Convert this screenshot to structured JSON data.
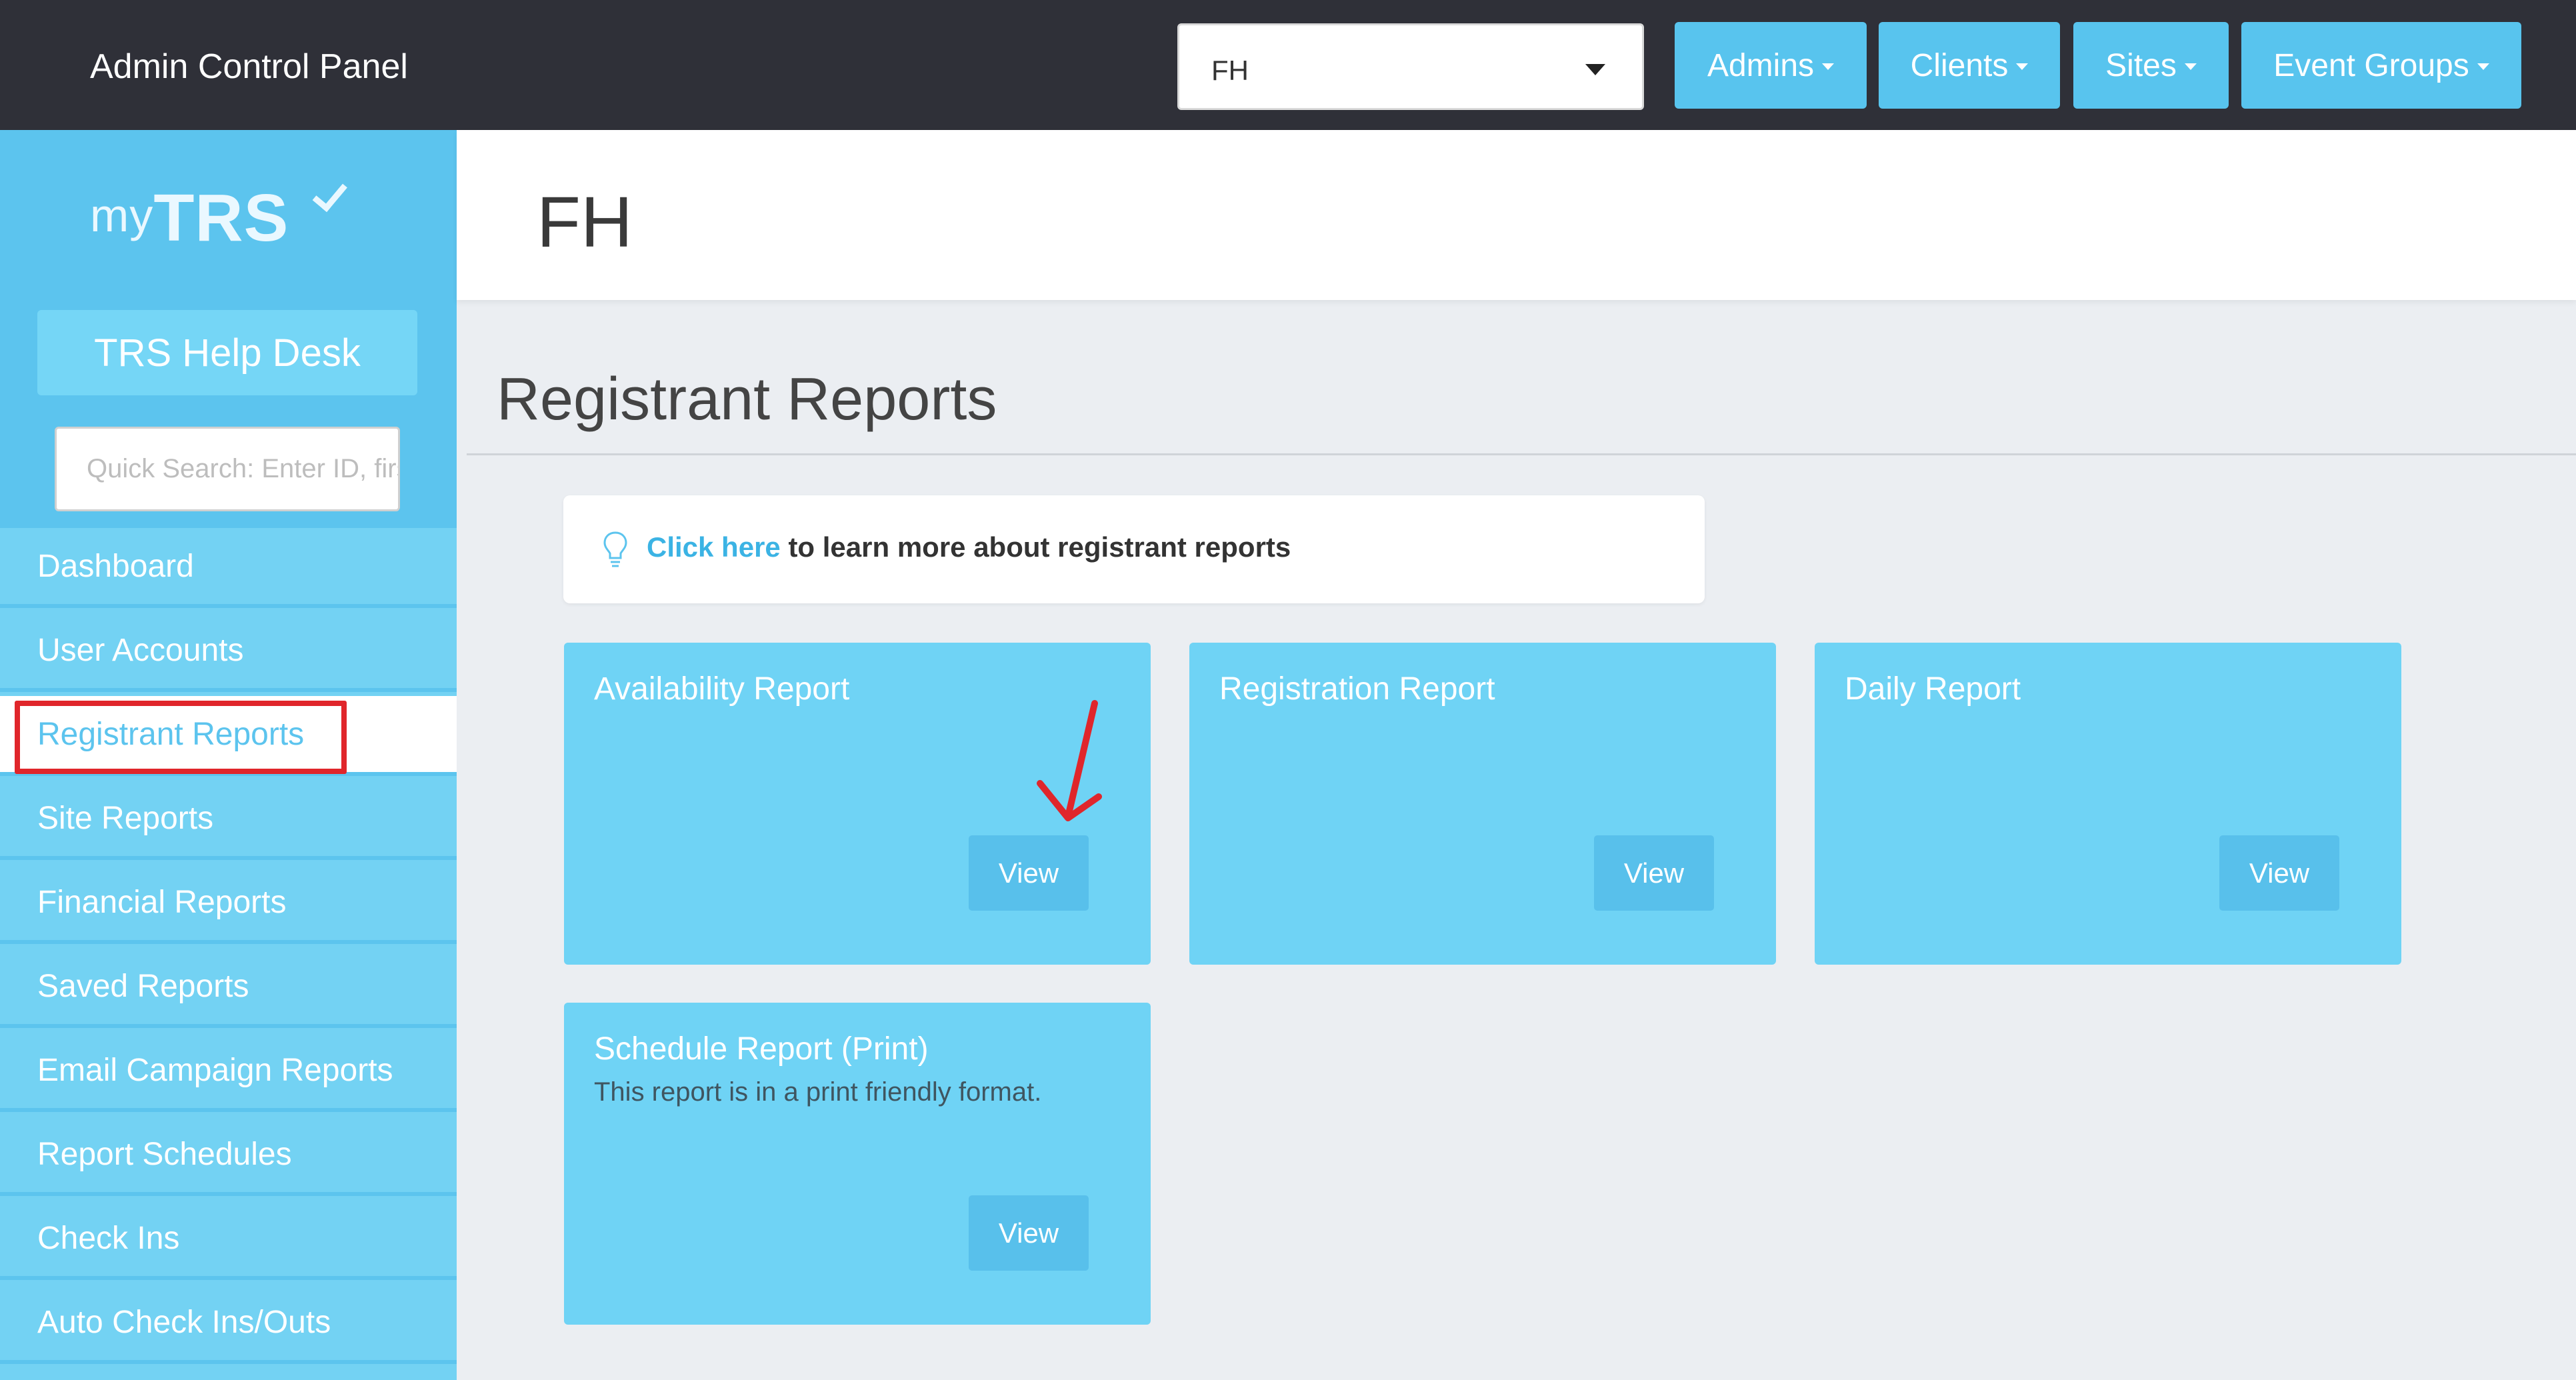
{
  "topbar": {
    "app_title": "Admin Control Panel",
    "client_select": {
      "value": "FH"
    },
    "menus": [
      {
        "label": "Admins"
      },
      {
        "label": "Clients"
      },
      {
        "label": "Sites"
      },
      {
        "label": "Event Groups"
      }
    ]
  },
  "sidebar": {
    "logo": {
      "prefix": "my",
      "brand": "TRS"
    },
    "help_desk_label": "TRS Help Desk",
    "quick_search": {
      "placeholder": "Quick Search: Enter ID, first or last name",
      "value": ""
    },
    "items": [
      {
        "label": "Dashboard",
        "active": false
      },
      {
        "label": "User Accounts",
        "active": false
      },
      {
        "label": "Registrant Reports",
        "active": true
      },
      {
        "label": "Site Reports",
        "active": false
      },
      {
        "label": "Financial Reports",
        "active": false
      },
      {
        "label": "Saved Reports",
        "active": false
      },
      {
        "label": "Email Campaign Reports",
        "active": false
      },
      {
        "label": "Report Schedules",
        "active": false
      },
      {
        "label": "Check Ins",
        "active": false
      },
      {
        "label": "Auto Check Ins/Outs",
        "active": false
      }
    ]
  },
  "main": {
    "page_title": "FH",
    "section_title": "Registrant Reports",
    "info": {
      "link_text": "Click here",
      "text": " to learn more about registrant reports"
    },
    "cards": [
      {
        "title": "Availability Report",
        "description": "",
        "button_label": "View"
      },
      {
        "title": "Registration Report",
        "description": "",
        "button_label": "View"
      },
      {
        "title": "Daily Report",
        "description": "",
        "button_label": "View"
      },
      {
        "title": "Schedule Report (Print)",
        "description": "This report is in a print friendly format.",
        "button_label": "View"
      }
    ]
  },
  "colors": {
    "topbar_bg": "#2f3038",
    "accent": "#58c4ee",
    "sidebar_item": "#73d2f3",
    "card_bg": "#6fd3f5",
    "annotation_red": "#e0262b"
  }
}
